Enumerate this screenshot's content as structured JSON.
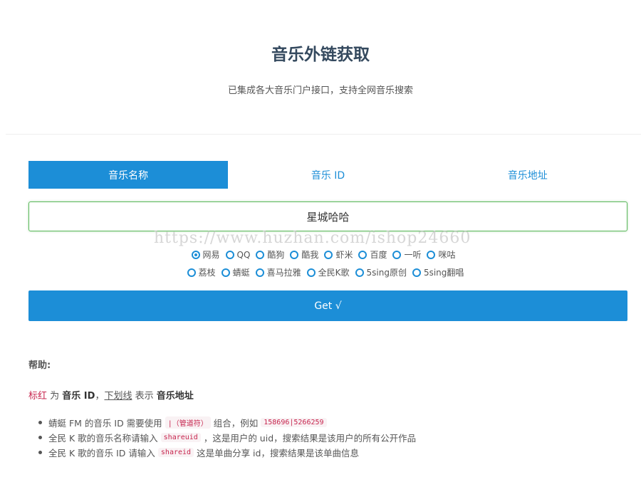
{
  "header": {
    "title": "音乐外链获取",
    "subtitle": "已集成各大音乐门户接口，支持全网音乐搜索"
  },
  "tabs": [
    {
      "label": "音乐名称",
      "active": true
    },
    {
      "label": "音乐 ID",
      "active": false
    },
    {
      "label": "音乐地址",
      "active": false
    }
  ],
  "search": {
    "value": "星城哈哈",
    "placeholder": ""
  },
  "watermark": "https://www.huzhan.com/ishop24660",
  "sources_row1": [
    {
      "label": "网易",
      "checked": true
    },
    {
      "label": "QQ",
      "checked": false
    },
    {
      "label": "酷狗",
      "checked": false
    },
    {
      "label": "酷我",
      "checked": false
    },
    {
      "label": "虾米",
      "checked": false
    },
    {
      "label": "百度",
      "checked": false
    },
    {
      "label": "一听",
      "checked": false
    },
    {
      "label": "咪咕",
      "checked": false
    }
  ],
  "sources_row2": [
    {
      "label": "荔枝",
      "checked": false
    },
    {
      "label": "蜻蜓",
      "checked": false
    },
    {
      "label": "喜马拉雅",
      "checked": false
    },
    {
      "label": "全民K歌",
      "checked": false
    },
    {
      "label": "5sing原创",
      "checked": false
    },
    {
      "label": "5sing翻唱",
      "checked": false
    }
  ],
  "get_button": "Get √",
  "help": {
    "title": "帮助:",
    "legend": {
      "red_text": "标红",
      "t1": " 为 ",
      "music_id": "音乐 ID",
      "t2": "，",
      "underline_text": "下划线",
      "t3": " 表示 ",
      "music_url": "音乐地址"
    },
    "items": [
      {
        "before": "蜻蜓 FM 的音乐 ID 需要使用",
        "code1": "|（管道符）",
        "middle": "组合，例如",
        "code2": "158696|5266259",
        "after": ""
      },
      {
        "before": "全民 K 歌的音乐名称请输入",
        "code1": "shareuid",
        "middle": "，这是用户的 uid，搜索结果是该用户的所有公开作品",
        "code2": "",
        "after": ""
      },
      {
        "before": "全民 K 歌的音乐 ID 请输入",
        "code1": "shareid",
        "middle": "这是单曲分享 id，搜索结果是该单曲信息",
        "code2": "",
        "after": ""
      }
    ]
  },
  "colors": {
    "primary": "#1c8ed7",
    "title": "#34495e",
    "input_border": "#5cb85c",
    "code_red": "#c7254e"
  }
}
